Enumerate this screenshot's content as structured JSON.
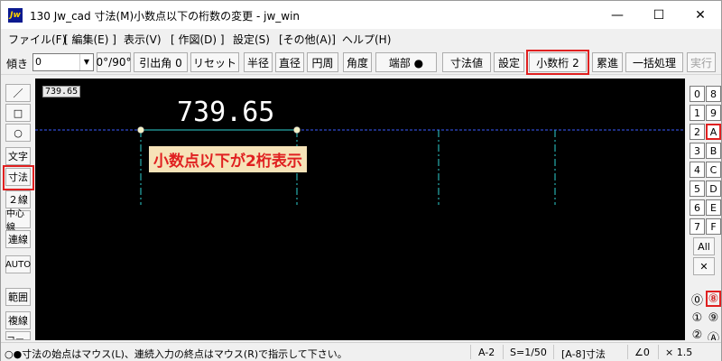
{
  "window": {
    "title": "130 Jw_cad 寸法(M)小数点以下の桁数の変更 - jw_win",
    "app_icon_text": "Jw",
    "controls": {
      "minimize": "—",
      "maximize": "☐",
      "close": "✕"
    }
  },
  "menu": [
    {
      "label": "ファイル(F)"
    },
    {
      "label": "[ 編集(E) ]"
    },
    {
      "label": "表示(V)"
    },
    {
      "label": "[ 作図(D) ]"
    },
    {
      "label": "設定(S)"
    },
    {
      "label": "[その他(A)]"
    },
    {
      "label": "ヘルプ(H)"
    }
  ],
  "toolbar": {
    "tilt_label": "傾き",
    "tilt_value": "0",
    "buttons": [
      {
        "label": "0°/90°"
      },
      {
        "label": "引出角 0"
      },
      {
        "label": "リセット"
      },
      {
        "label": "半径"
      },
      {
        "label": "直径"
      },
      {
        "label": "円周"
      },
      {
        "label": "角度"
      },
      {
        "label": "端部 ●"
      },
      {
        "label": "寸法値"
      },
      {
        "label": "設定"
      },
      {
        "label": "小数桁 2"
      },
      {
        "label": "累進"
      },
      {
        "label": "一括処理"
      },
      {
        "label": "実行"
      }
    ]
  },
  "left_tools": [
    {
      "label": "／"
    },
    {
      "label": "□"
    },
    {
      "label": "○"
    },
    {
      "label": "文字"
    },
    {
      "label": "寸法"
    },
    {
      "label": "２線"
    },
    {
      "label": "中心線"
    },
    {
      "label": "連線"
    },
    {
      "label": "AUTO"
    },
    {
      "label": "範囲"
    },
    {
      "label": "複線"
    },
    {
      "label": "コーナー"
    }
  ],
  "canvas": {
    "readout": "739.65",
    "dimension_value": "739.65",
    "annotation": "小数点以下が2桁表示"
  },
  "right_tools": {
    "layers_left": [
      "0",
      "1",
      "2",
      "3",
      "4",
      "5",
      "6",
      "7"
    ],
    "layers_right": [
      "8",
      "9",
      "A",
      "B",
      "C",
      "D",
      "E",
      "F"
    ],
    "all_label": "All",
    "close_label": "✕",
    "groups_left": [
      "⓪",
      "①",
      "②"
    ],
    "groups_right": [
      "⑧",
      "⑨",
      "Ⓐ"
    ]
  },
  "status": {
    "message": "○●寸法の始点はマウス(L)、連続入力の終点はマウス(R)で指示して下さい。",
    "paper": "A-2",
    "scale": "S=1/50",
    "layer": "[A-8]寸法",
    "angle": "∠0",
    "zoom": "× 1.5"
  },
  "colors": {
    "highlight_box": "#e02020",
    "annotation_bg": "#f6e3b8",
    "annotation_text": "#e02020",
    "canvas_bg": "#000000",
    "aux_line": "#3a5bff",
    "dim_line": "#2ecfcf"
  }
}
